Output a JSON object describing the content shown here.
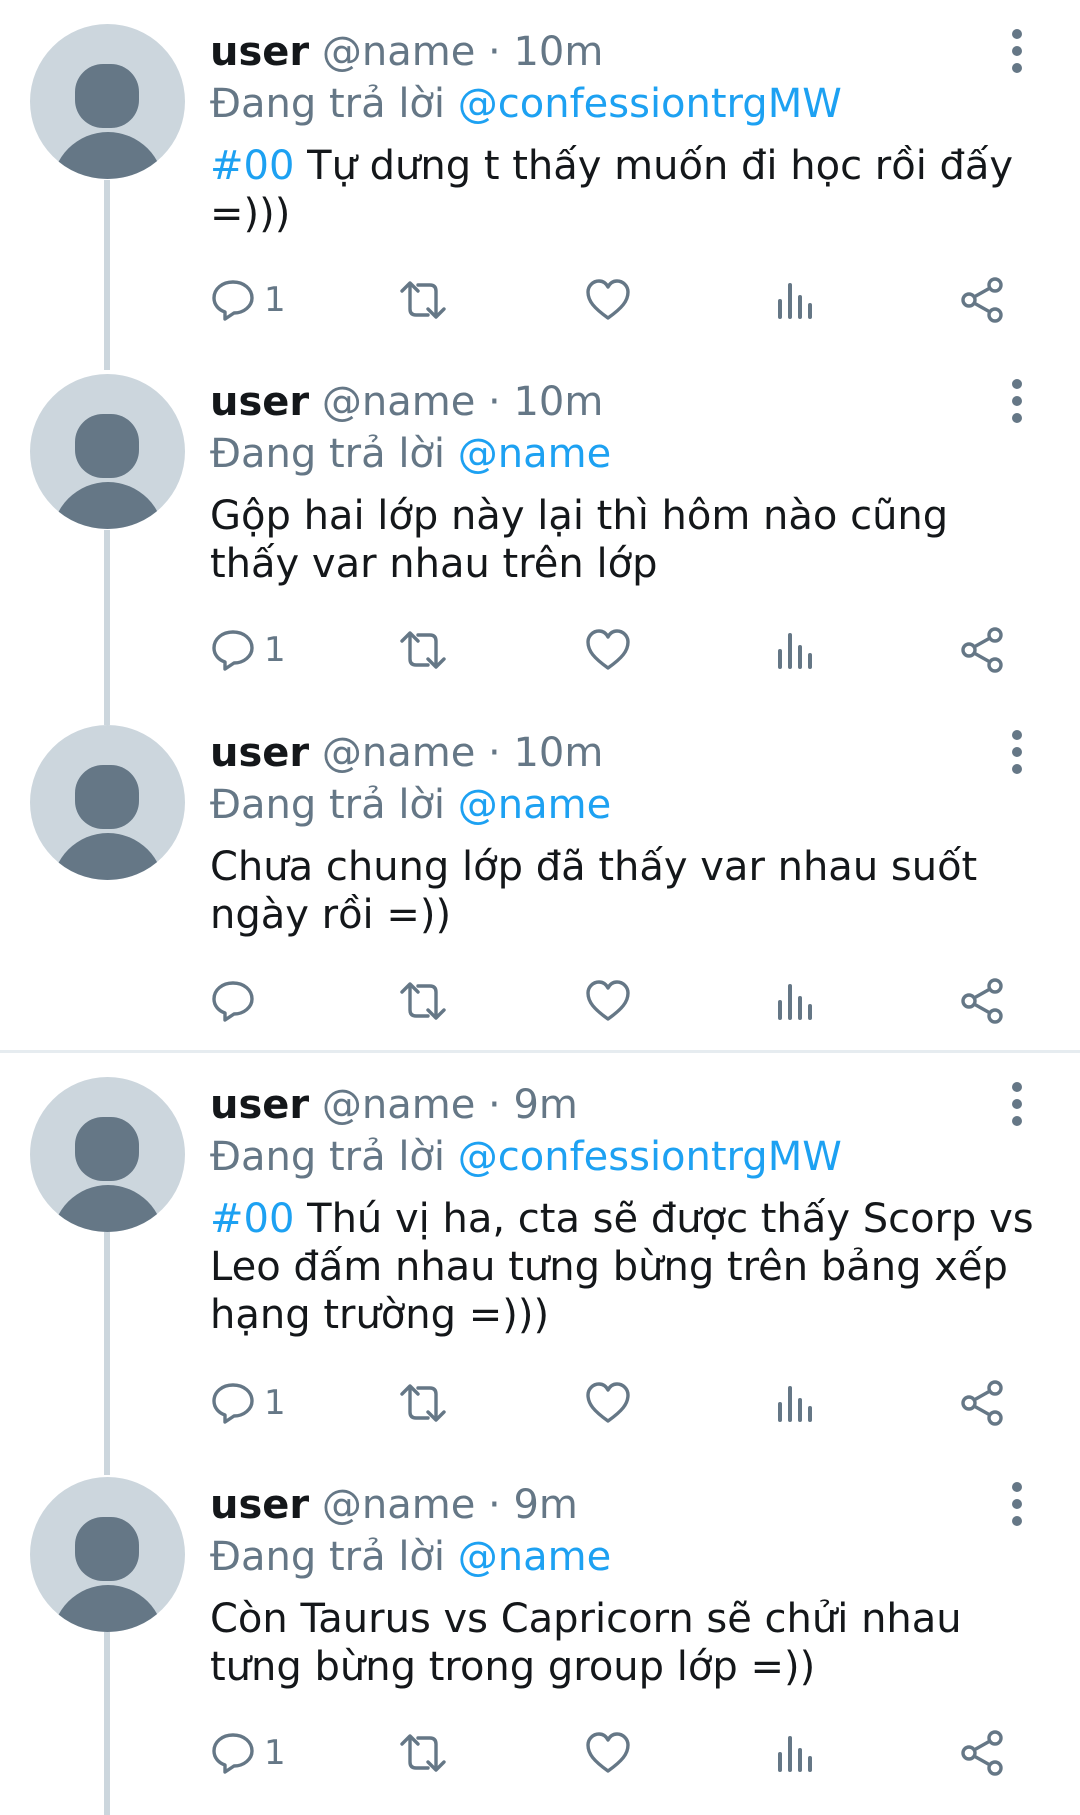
{
  "tweets": [
    {
      "username": "user",
      "handle": "@name",
      "separator": "·",
      "time": "10m",
      "reply_prefix": "Đang trả lời",
      "reply_to": "@confessiontrgMW",
      "hashtag": "#00",
      "text": " Tự dưng t thấy muốn đi học rồi đấy =)))",
      "reply_count": "1"
    },
    {
      "username": "user",
      "handle": "@name",
      "separator": "·",
      "time": "10m",
      "reply_prefix": "Đang trả lời",
      "reply_to": "@name",
      "hashtag": "",
      "text": "Gộp hai lớp này lại thì hôm nào cũng thấy var nhau trên lớp",
      "reply_count": "1"
    },
    {
      "username": "user",
      "handle": "@name",
      "separator": "·",
      "time": "10m",
      "reply_prefix": "Đang trả lời",
      "reply_to": "@name",
      "hashtag": "",
      "text": "Chưa chung lớp đã thấy var nhau suốt ngày rồi =))",
      "reply_count": ""
    },
    {
      "username": "user",
      "handle": "@name",
      "separator": "·",
      "time": "9m",
      "reply_prefix": "Đang trả lời",
      "reply_to": "@confessiontrgMW",
      "hashtag": "#00",
      "text": " Thú vị ha, cta sẽ được thấy Scorp vs Leo đấm nhau tưng bừng trên bảng xếp hạng trường =)))",
      "reply_count": "1"
    },
    {
      "username": "user",
      "handle": "@name",
      "separator": "·",
      "time": "9m",
      "reply_prefix": "Đang trả lời",
      "reply_to": "@name",
      "hashtag": "",
      "text": "Còn Taurus vs Capricorn sẽ chửi nhau tưng bừng trong group lớp =))",
      "reply_count": "1"
    }
  ],
  "icons": {
    "reply": "reply-icon",
    "retweet": "retweet-icon",
    "like": "heart-icon",
    "analytics": "analytics-icon",
    "share": "share-icon",
    "more": "more-vertical-icon"
  },
  "colors": {
    "link": "#1da1f2",
    "secondary": "#657786",
    "thread_line": "#ccd6dd",
    "divider": "#e6ecf0",
    "avatar_bg": "#ccd6dd",
    "avatar_fg": "#657786"
  }
}
